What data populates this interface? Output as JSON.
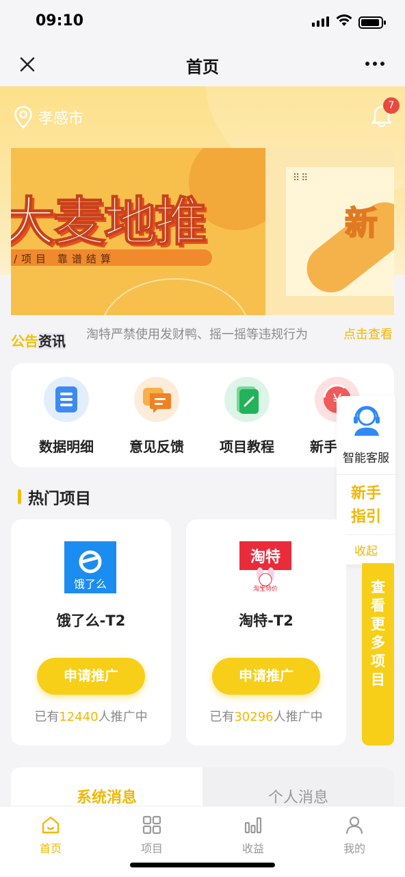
{
  "status_bar": {
    "time": "09:10"
  },
  "navbar": {
    "title": "首页"
  },
  "location": {
    "city": "孝感市"
  },
  "notifications": {
    "count": "7"
  },
  "banner": {
    "title": "大麦地推",
    "subtitle": "/项目  靠谱结算",
    "right_text": "新"
  },
  "notice": {
    "label_a": "公告",
    "label_b": "资讯",
    "text": "淘特严禁使用发财鸭、摇一摇等违规行为",
    "link": "点击查看"
  },
  "menu": [
    {
      "label": "数据明细",
      "icon": "data-detail-icon"
    },
    {
      "label": "意见反馈",
      "icon": "feedback-icon"
    },
    {
      "label": "项目教程",
      "icon": "tutorial-icon"
    },
    {
      "label": "新手教程",
      "icon": "newbie-tutorial-icon"
    }
  ],
  "service": {
    "label": "智能客服",
    "guide_line1": "新手",
    "guide_line2": "指引",
    "collapse": "收起"
  },
  "hot_section": {
    "title": "热门项目"
  },
  "projects": [
    {
      "name": "饿了么-T2",
      "button": "申请推广",
      "count_prefix": "已有",
      "count": "12440",
      "count_suffix": "人推广中",
      "logo_text": "饿了么"
    },
    {
      "name": "淘特-T2",
      "button": "申请推广",
      "count_prefix": "已有",
      "count": "30296",
      "count_suffix": "人推广中",
      "logo_text": "淘特",
      "logo_sub": "淘宝特价"
    }
  ],
  "more_projects": {
    "label": "查看更多项目"
  },
  "messages": {
    "tab_system": "系统消息",
    "tab_personal": "个人消息"
  },
  "tabbar": [
    {
      "label": "首页",
      "icon": "home-icon",
      "active": true
    },
    {
      "label": "项目",
      "icon": "grid-icon",
      "active": false
    },
    {
      "label": "收益",
      "icon": "bar-chart-icon",
      "active": false
    },
    {
      "label": "我的",
      "icon": "user-icon",
      "active": false
    }
  ],
  "colors": {
    "accent": "#f7cf18",
    "accent_text": "#f2b705",
    "badge": "#e84a3f"
  }
}
